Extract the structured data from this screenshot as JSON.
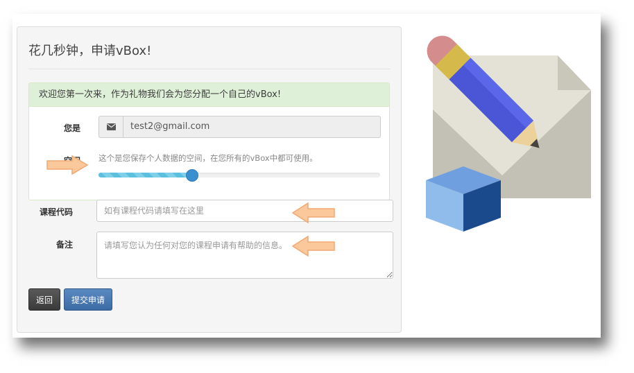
{
  "form": {
    "title": "花几秒钟，申请vBox!",
    "welcome_message": "欢迎您第一次来，作为礼物我们会为您分配一个自己的vBox!",
    "user_label": "您是",
    "email_value": "test2@gmail.com",
    "space_label": "空间",
    "space_hint": "这个是您保存个人数据的空间，在您所有的vBox中都可使用。",
    "space_slider_fraction": 0.33,
    "course_code_label": "课程代码",
    "course_code_placeholder": "如有课程代码请填写在这里",
    "notes_label": "备注",
    "notes_placeholder": "请填写您认为任何对您的课程申请有帮助的信息。",
    "back_button": "返回",
    "submit_button": "提交申请"
  },
  "icons": {
    "email_addon": "envelope-icon",
    "callouts": "arrow-callout-icon",
    "illustration": "pencil-paper-cube-illustration"
  },
  "colors": {
    "panel_bg": "#f5f5f5",
    "success_bg": "#dff0d8",
    "slider_fill": "#5bc0de",
    "slider_handle": "#3a8fd0",
    "submit_button": "#3c6aa4",
    "back_button": "#3a3a3a",
    "callout_arrow": "#fbc89c"
  }
}
